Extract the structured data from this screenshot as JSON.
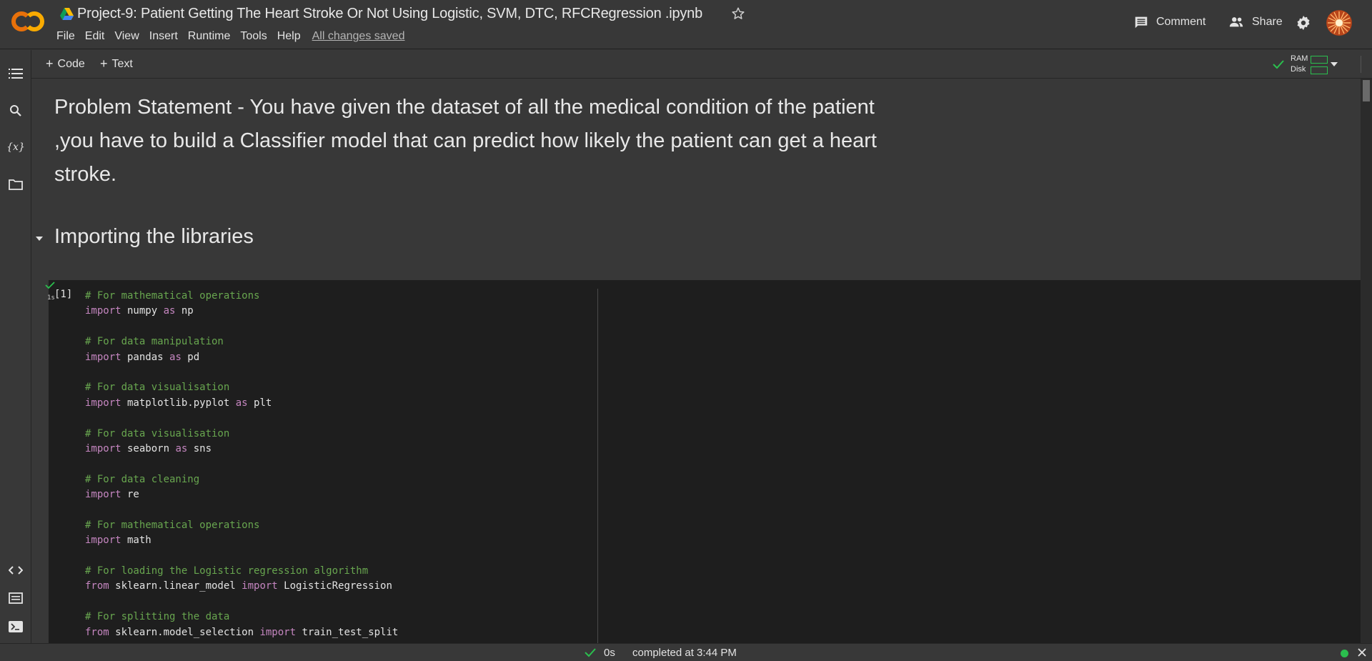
{
  "header": {
    "title": "Project-9: Patient Getting The Heart Stroke Or Not Using Logistic,  SVM, DTC, RFCRegression .ipynb",
    "logo_text": "CO",
    "menu": [
      "File",
      "Edit",
      "View",
      "Insert",
      "Runtime",
      "Tools",
      "Help"
    ],
    "saved_status": "All changes saved",
    "comment_label": "Comment",
    "share_label": "Share"
  },
  "toolbar": {
    "add_code_label": "Code",
    "add_text_label": "Text",
    "ram_label": "RAM",
    "disk_label": "Disk"
  },
  "sidebar": {
    "icons": [
      "table-of-contents-icon",
      "search-icon",
      "variables-icon",
      "files-icon"
    ],
    "bottom_icons": [
      "code-snippets-icon",
      "command-palette-icon",
      "terminal-icon"
    ],
    "variables_glyph": "{x}"
  },
  "notebook": {
    "text_cell": "Problem Statement - You have given the dataset of all the medical condition of the patient ,you have to build a Classifier model that can predict how likely the patient can get a heart stroke.",
    "section_heading": "Importing the libraries",
    "code_cell": {
      "exec_count": "[1]",
      "exec_time": "1s",
      "lines": [
        [
          {
            "t": "cm",
            "v": "# For mathematical operations"
          }
        ],
        [
          {
            "t": "kw",
            "v": "import"
          },
          {
            "t": "tx",
            "v": " numpy "
          },
          {
            "t": "kw",
            "v": "as"
          },
          {
            "t": "tx",
            "v": " np"
          }
        ],
        [],
        [
          {
            "t": "cm",
            "v": "# For data manipulation"
          }
        ],
        [
          {
            "t": "kw",
            "v": "import"
          },
          {
            "t": "tx",
            "v": " pandas "
          },
          {
            "t": "kw",
            "v": "as"
          },
          {
            "t": "tx",
            "v": " pd"
          }
        ],
        [],
        [
          {
            "t": "cm",
            "v": "# For data visualisation"
          }
        ],
        [
          {
            "t": "kw",
            "v": "import"
          },
          {
            "t": "tx",
            "v": " matplotlib.pyplot "
          },
          {
            "t": "kw",
            "v": "as"
          },
          {
            "t": "tx",
            "v": " plt"
          }
        ],
        [],
        [
          {
            "t": "cm",
            "v": "# For data visualisation"
          }
        ],
        [
          {
            "t": "kw",
            "v": "import"
          },
          {
            "t": "tx",
            "v": " seaborn "
          },
          {
            "t": "kw",
            "v": "as"
          },
          {
            "t": "tx",
            "v": " sns"
          }
        ],
        [],
        [
          {
            "t": "cm",
            "v": "# For data cleaning"
          }
        ],
        [
          {
            "t": "kw",
            "v": "import"
          },
          {
            "t": "tx",
            "v": " re"
          }
        ],
        [],
        [
          {
            "t": "cm",
            "v": "# For mathematical operations"
          }
        ],
        [
          {
            "t": "kw",
            "v": "import"
          },
          {
            "t": "tx",
            "v": " math"
          }
        ],
        [],
        [
          {
            "t": "cm",
            "v": "# For loading the Logistic regression algorithm"
          }
        ],
        [
          {
            "t": "kw",
            "v": "from"
          },
          {
            "t": "tx",
            "v": " sklearn.linear_model "
          },
          {
            "t": "kw",
            "v": "import"
          },
          {
            "t": "tx",
            "v": " LogisticRegression"
          }
        ],
        [],
        [
          {
            "t": "cm",
            "v": "# For splitting the data"
          }
        ],
        [
          {
            "t": "kw",
            "v": "from"
          },
          {
            "t": "tx",
            "v": " sklearn.model_selection "
          },
          {
            "t": "kw",
            "v": "import"
          },
          {
            "t": "tx",
            "v": " train_test_split"
          }
        ]
      ]
    }
  },
  "status": {
    "duration": "0s",
    "text": "completed at 3:44 PM"
  },
  "colors": {
    "accent_orange": "#f9ab00",
    "success_green": "#2bbf4e",
    "comment_green": "#68a64f",
    "keyword_pink": "#c586c0"
  }
}
